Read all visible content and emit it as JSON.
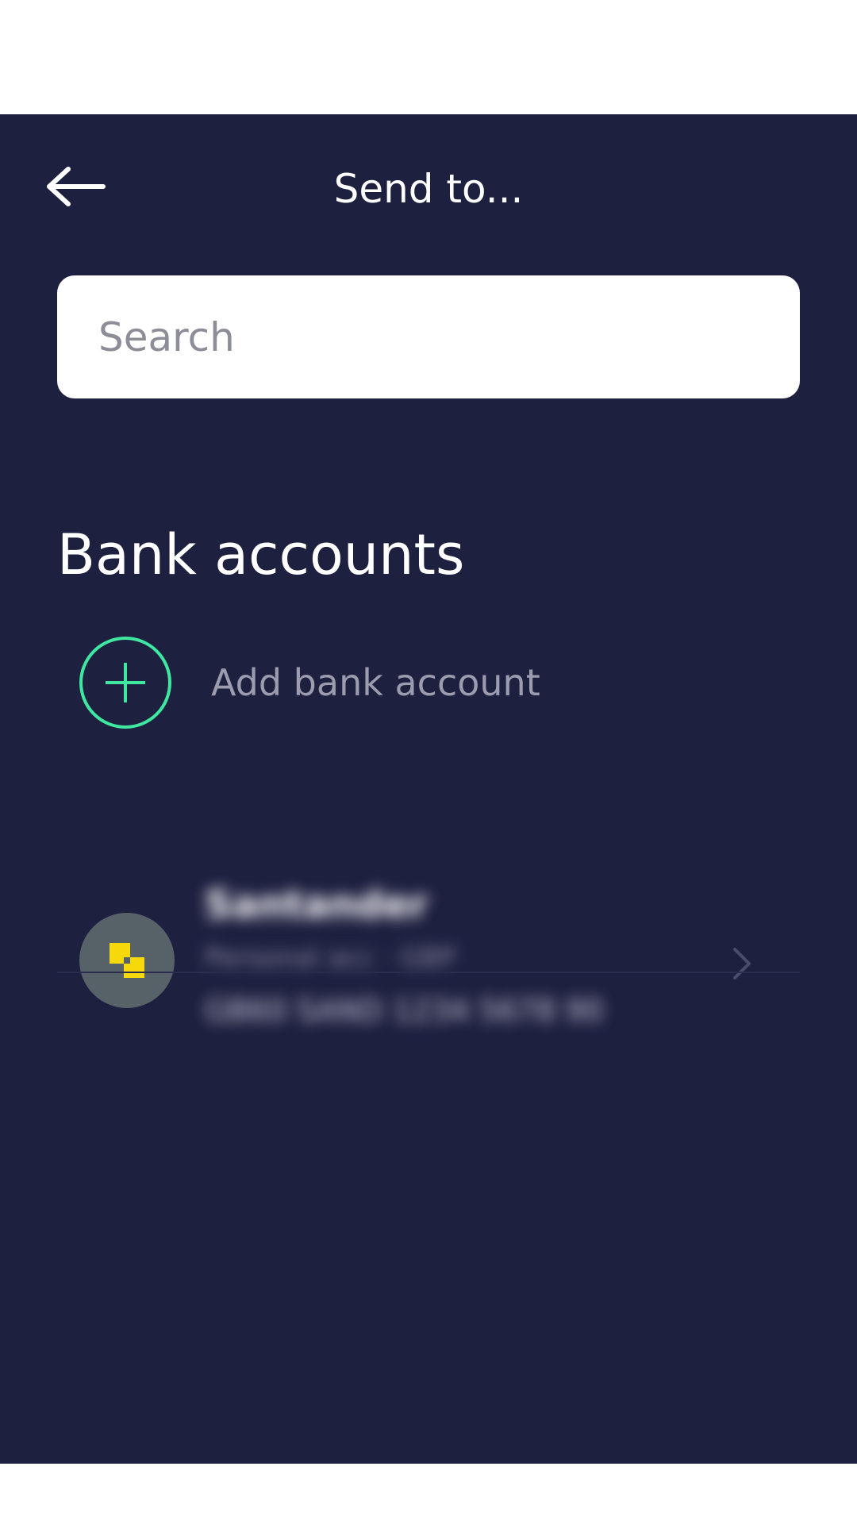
{
  "header": {
    "title": "Send to..."
  },
  "search": {
    "placeholder": "Search",
    "value": ""
  },
  "bank_accounts": {
    "section_title": "Bank accounts",
    "add_label": "Add bank account",
    "accounts": [
      {
        "name": "Santander",
        "subtitle": "Personal acc · GBP",
        "number": "GB60 SAND 1234 5678 90"
      }
    ]
  },
  "colors": {
    "background": "#1e2040",
    "accent": "#3ee8a0",
    "bank_logo": "#f5d90a"
  },
  "icons": {
    "back": "arrow-left-icon",
    "add": "plus-icon",
    "chevron": "chevron-right-icon"
  }
}
